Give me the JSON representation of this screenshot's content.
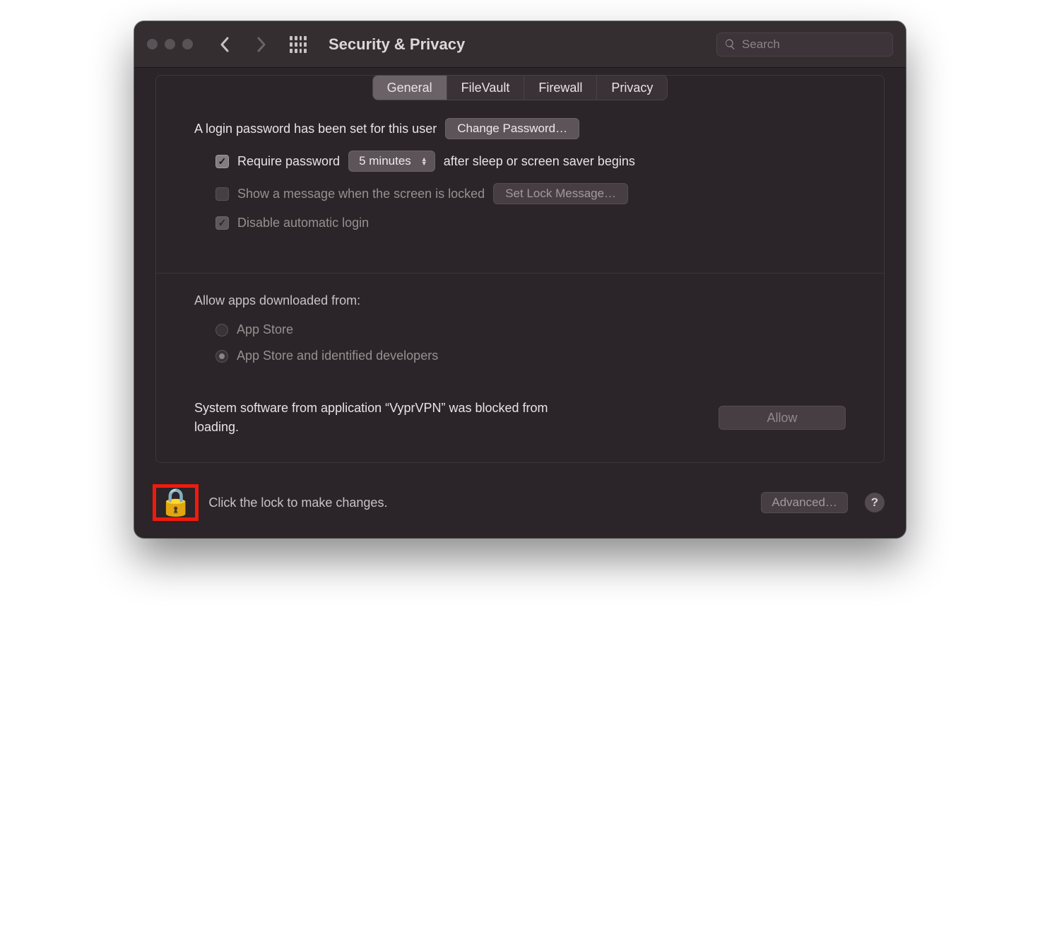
{
  "window": {
    "title": "Security & Privacy"
  },
  "search": {
    "placeholder": "Search"
  },
  "tabs": {
    "general": "General",
    "filevault": "FileVault",
    "firewall": "Firewall",
    "privacy": "Privacy"
  },
  "general": {
    "login_password_set": "A login password has been set for this user",
    "change_password_btn": "Change Password…",
    "require_password_label": "Require password",
    "require_password_delay": "5 minutes",
    "require_password_suffix": "after sleep or screen saver begins",
    "show_lock_message_label": "Show a message when the screen is locked",
    "set_lock_message_btn": "Set Lock Message…",
    "disable_auto_login_label": "Disable automatic login",
    "allow_apps_heading": "Allow apps downloaded from:",
    "allow_apps_option1": "App Store",
    "allow_apps_option2": "App Store and identified developers",
    "blocked_message": "System software from application “VyprVPN” was blocked from loading.",
    "allow_btn": "Allow"
  },
  "footer": {
    "lock_text": "Click the lock to make changes.",
    "advanced_btn": "Advanced…",
    "help": "?"
  }
}
